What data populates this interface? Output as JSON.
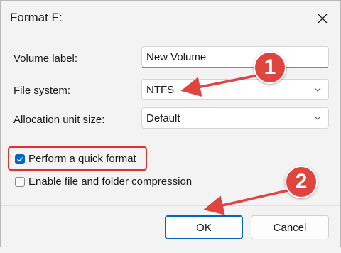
{
  "dialog": {
    "title": "Format F:",
    "close_icon": "close-icon"
  },
  "form": {
    "volume_label": {
      "label": "Volume label:",
      "value": "New Volume"
    },
    "file_system": {
      "label": "File system:",
      "value": "NTFS",
      "icon": "chevron-down-icon"
    },
    "allocation_unit_size": {
      "label": "Allocation unit size:",
      "value": "Default",
      "icon": "chevron-down-icon"
    }
  },
  "options": {
    "quick_format": {
      "label": "Perform a quick format",
      "checked": true
    },
    "compression": {
      "label": "Enable file and folder compression",
      "checked": false
    }
  },
  "buttons": {
    "ok_label": "OK",
    "cancel_label": "Cancel"
  },
  "annotations": {
    "badge_1": "1",
    "badge_2": "2",
    "color": "#e0443e",
    "box_color": "#e03131"
  },
  "colors": {
    "accent": "#0067c0",
    "background": "#f3f3f3"
  }
}
